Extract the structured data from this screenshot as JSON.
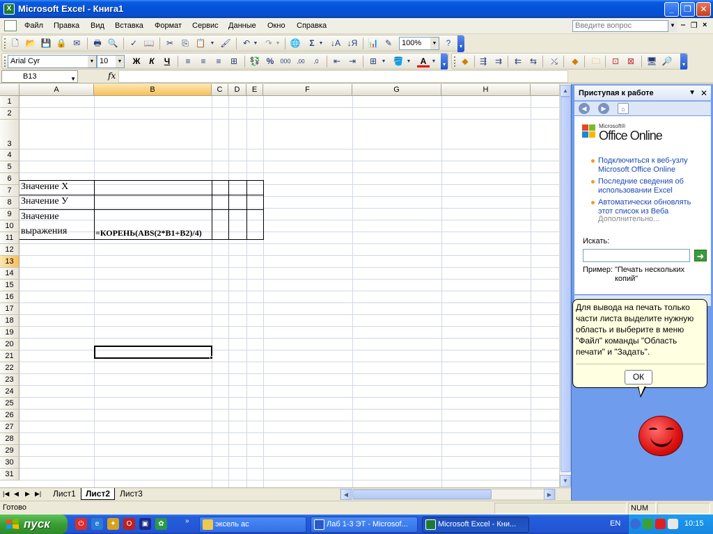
{
  "window": {
    "title": "Microsoft Excel - Книга1"
  },
  "menu": {
    "items": [
      "Файл",
      "Правка",
      "Вид",
      "Вставка",
      "Формат",
      "Сервис",
      "Данные",
      "Окно",
      "Справка"
    ],
    "ask_placeholder": "Введите вопрос"
  },
  "toolbar": {
    "zoom": "100%",
    "font": "Arial Cyr",
    "size": "10"
  },
  "formula": {
    "cell_ref": "B13",
    "fx": "fx",
    "value": ""
  },
  "columns": [
    "A",
    "B",
    "C",
    "D",
    "E",
    "F",
    "G",
    "H"
  ],
  "rows": [
    "1",
    "2",
    "3",
    "4",
    "5",
    "6",
    "7",
    "8",
    "9",
    "10",
    "11",
    "12",
    "13",
    "14",
    "15",
    "16",
    "17",
    "18",
    "19",
    "20",
    "21",
    "22",
    "23",
    "24",
    "25",
    "26",
    "27",
    "28",
    "29",
    "30",
    "31"
  ],
  "cells": {
    "a1": "Значение X",
    "a2": "Значение У",
    "a3_line1": "Значение",
    "a3_line2": "выражения",
    "b3": "=КОРЕНЬ(ABS(2*B1+B2)/4)"
  },
  "selected_cell": "B13",
  "sheets": [
    "Лист1",
    "Лист2",
    "Лист3"
  ],
  "active_sheet": "Лист2",
  "status": {
    "text": "Готово",
    "num": "NUM"
  },
  "taskpane": {
    "title": "Приступая к работе",
    "logo_small": "Microsoft®",
    "logo": "Office Online",
    "links": [
      "Подключиться к веб-узлу Microsoft Office Online",
      "Последние сведения об использовании Excel",
      "Автоматически обновлять этот список из Веба"
    ],
    "more": "Дополнительно...",
    "search_label": "Искать:",
    "example_label": "Пример:",
    "example_value": "\"Печать нескольких копий\""
  },
  "balloon": {
    "text": "Для вывода на печать только части листа выделите нужную область и выберите в меню \"Файл\" команды \"Область печати\" и \"Задать\".",
    "ok": "ОК"
  },
  "taskbar": {
    "start": "пуск",
    "tasks": [
      "эксель ас",
      "Лаб 1-3 ЭТ - Microsof...",
      "Microsoft Excel - Кни..."
    ],
    "lang": "EN",
    "time": "10:15"
  },
  "colors": {
    "accent": "#0a5be0",
    "selected_header": "#f7c05a",
    "taskpane": "#6f9cec"
  }
}
